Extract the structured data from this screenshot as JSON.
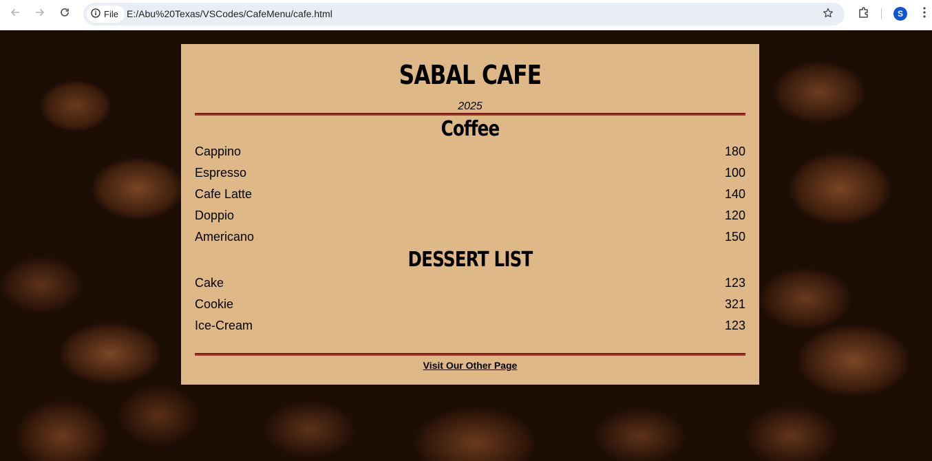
{
  "browser": {
    "chip_label": "File",
    "url": "E:/Abu%20Texas/VSCodes/CafeMenu/cafe.html",
    "profile_initial": "S",
    "icons": [
      "back-arrow-icon",
      "forward-arrow-icon",
      "reload-icon",
      "info-icon",
      "star-icon",
      "extensions-icon",
      "kebab-menu-icon"
    ]
  },
  "page": {
    "title": "SABAL CAFE",
    "established": "2025",
    "sections": [
      {
        "heading": "Coffee",
        "items": [
          {
            "name": "Cappino",
            "price": "180"
          },
          {
            "name": "Espresso",
            "price": "100"
          },
          {
            "name": "Cafe Latte",
            "price": "140"
          },
          {
            "name": "Doppio",
            "price": "120"
          },
          {
            "name": "Americano",
            "price": "150"
          }
        ]
      },
      {
        "heading": "DESSERT LIST",
        "items": [
          {
            "name": "Cake",
            "price": "123"
          },
          {
            "name": "Cookie",
            "price": "321"
          },
          {
            "name": "Ice-Cream",
            "price": "123"
          }
        ]
      }
    ],
    "footer_link": "Visit Our Other Page"
  },
  "colors": {
    "card": "#deb887",
    "divider": "#7e1c1c",
    "omnibox": "#e9eef6",
    "avatar": "#0b57d0"
  }
}
